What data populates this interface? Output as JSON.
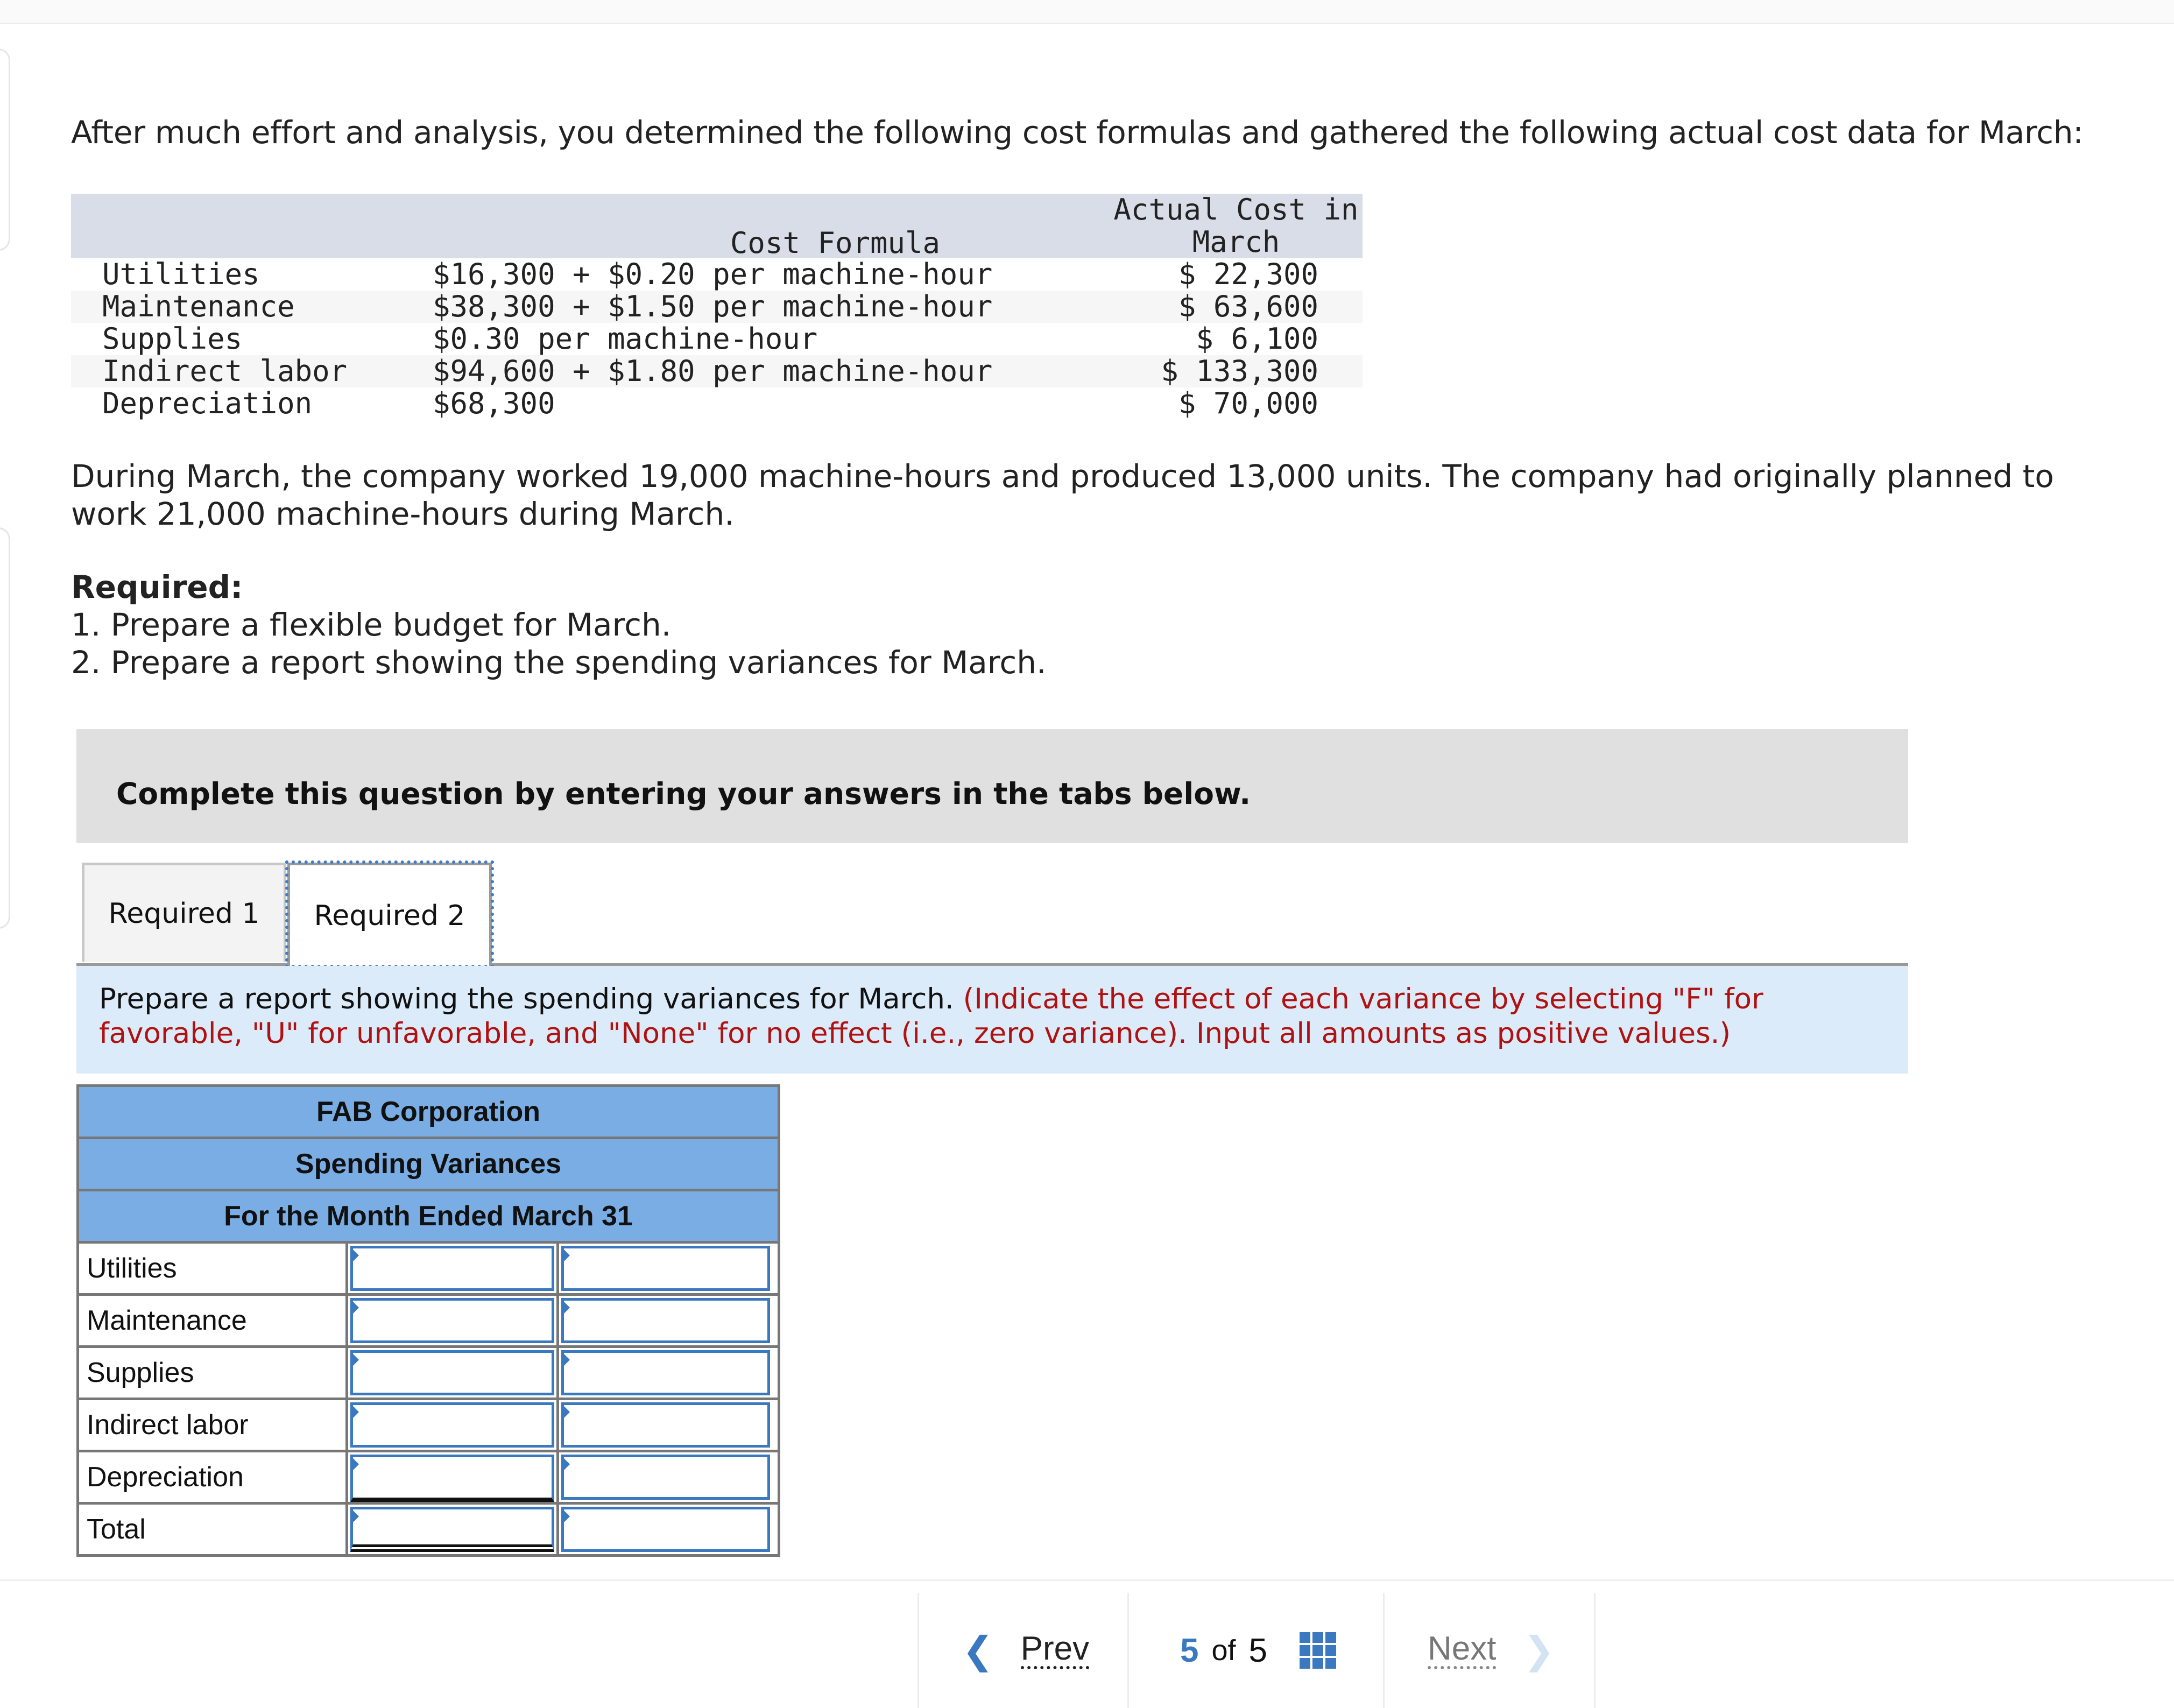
{
  "intro": "After much effort and analysis, you determined the following cost formulas and gathered the following actual cost data for March:",
  "cost_table": {
    "headers": {
      "formula": "Cost Formula",
      "actual_line1": "Actual Cost in",
      "actual_line2": "March"
    },
    "rows": [
      {
        "name": "Utilities",
        "formula": "$16,300 + $0.20 per machine-hour",
        "actual": "$ 22,300"
      },
      {
        "name": "Maintenance",
        "formula": "$38,300 + $1.50 per machine-hour",
        "actual": "$ 63,600"
      },
      {
        "name": "Supplies",
        "formula": "$0.30 per machine-hour",
        "actual": "$ 6,100"
      },
      {
        "name": "Indirect labor",
        "formula": "$94,600 + $1.80 per machine-hour",
        "actual": "$ 133,300"
      },
      {
        "name": "Depreciation",
        "formula": "$68,300",
        "actual": "$ 70,000"
      }
    ]
  },
  "paragraph": "During March, the company worked 19,000 machine-hours and produced 13,000 units. The company had originally planned to work 21,000 machine-hours during March.",
  "required": {
    "title": "Required:",
    "items": [
      "1. Prepare a flexible budget for March.",
      "2. Prepare a report showing the spending variances for March."
    ]
  },
  "complete_banner": "Complete this question by entering your answers in the tabs below.",
  "tabs": [
    {
      "label": "Required 1",
      "active": false
    },
    {
      "label": "Required 2",
      "active": true
    }
  ],
  "instructions": {
    "main": "Prepare a report showing the spending variances for March.",
    "note": "(Indicate the effect of each variance by selecting \"F\" for favorable, \"U\" for unfavorable, and \"None\" for no effect (i.e., zero variance). Input all amounts as positive values.)"
  },
  "report": {
    "company": "FAB Corporation",
    "title": "Spending Variances",
    "period": "For the Month Ended March 31",
    "rows": [
      {
        "label": "Utilities",
        "amount": "",
        "effect": ""
      },
      {
        "label": "Maintenance",
        "amount": "",
        "effect": ""
      },
      {
        "label": "Supplies",
        "amount": "",
        "effect": ""
      },
      {
        "label": "Indirect labor",
        "amount": "",
        "effect": ""
      },
      {
        "label": "Depreciation",
        "amount": "",
        "effect": ""
      },
      {
        "label": "Total",
        "amount": "",
        "effect": ""
      }
    ]
  },
  "pager": {
    "prev_label": "Prev",
    "current": "5",
    "of_label": "of",
    "total": "5",
    "next_label": "Next",
    "icons": {
      "prev": "chevron-left-icon",
      "grid": "grid-icon",
      "next": "chevron-right-icon"
    }
  },
  "colors": {
    "accent": "#3a78c0",
    "header_blue": "#7aade4",
    "instruction_bg": "#dcebf9",
    "note_red": "#b01212"
  }
}
